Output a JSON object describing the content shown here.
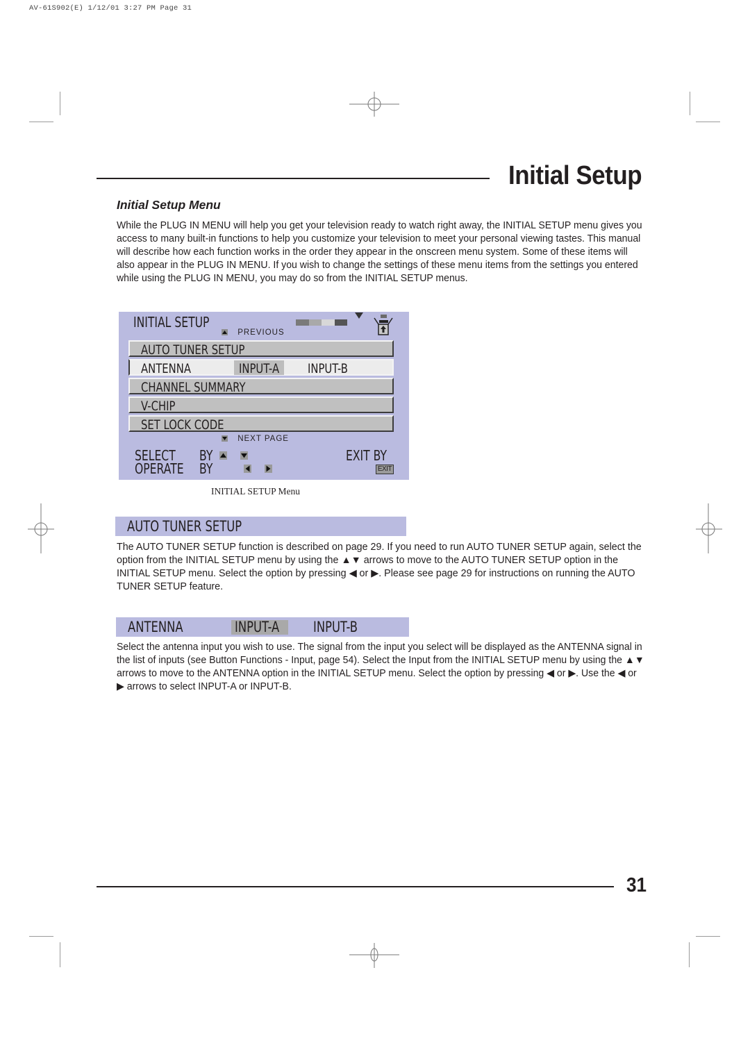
{
  "print_slug": "AV-61S902(E)  1/12/01  3:27 PM  Page 31",
  "header": {
    "title": "Initial Setup"
  },
  "section": {
    "subtitle": "Initial Setup Menu",
    "intro": "While the PLUG IN MENU will help you get your television ready to watch right away, the INITIAL SETUP menu gives you access to many built-in functions to help you customize your television to meet your personal viewing tastes. This manual will describe how each function works in the order they appear in the onscreen menu system. Some of these items will also appear in the PLUG IN MENU. If you wish to change the settings of these menu items from the settings you entered while using the PLUG IN MENU, you may do so from the INITIAL SETUP menus."
  },
  "osd_menu": {
    "title": "INITIAL SETUP",
    "previous_label": "PREVIOUS",
    "next_label": "NEXT  PAGE",
    "progress_segments": [
      "#7a7a7a",
      "#a9a9a9",
      "#d8d8d8",
      "#555555"
    ],
    "items": [
      {
        "label": "AUTO TUNER SETUP"
      },
      {
        "label": "ANTENNA",
        "option_a": "INPUT-A",
        "option_b": "INPUT-B",
        "selected_option": "INPUT-A"
      },
      {
        "label": "CHANNEL SUMMARY"
      },
      {
        "label": "V-CHIP"
      },
      {
        "label": "SET LOCK CODE"
      }
    ],
    "hints": {
      "select": "SELECT",
      "operate": "OPERATE",
      "by": "BY",
      "exit_by": "EXIT  BY",
      "exit_key": "EXIT"
    },
    "caption": "INITIAL SETUP Menu"
  },
  "auto_tuner": {
    "heading": "AUTO TUNER SETUP",
    "text_parts": [
      "The AUTO TUNER SETUP function is described on page 29. If you need to run AUTO TUNER SETUP again, select the option from the INITIAL SETUP menu by using the ",
      "▲▼",
      " arrows to move to the AUTO TUNER SETUP option in the INITIAL SETUP menu. Select the option by pressing ",
      "◀",
      " or ",
      "▶",
      ". Please see page 29 for instructions on running the AUTO TUNER SETUP feature."
    ]
  },
  "antenna": {
    "heading": "ANTENNA",
    "option_a": "INPUT-A",
    "option_b": "INPUT-B",
    "text_parts": [
      "Select the antenna input you wish to use. The signal from the input you select will be displayed as the ANTENNA signal in the list of inputs (see Button Functions - Input, page 54). Select the Input from the INITIAL SETUP menu by using the ",
      "▲▼",
      "  arrows to move to the ANTENNA option in the INITIAL SETUP menu. Select the option by pressing ",
      "◀",
      " or ",
      "▶",
      ". Use the ",
      "◀",
      " or ",
      "▶",
      " arrows to select INPUT-A or INPUT-B."
    ]
  },
  "footer": {
    "page_number": "31"
  }
}
